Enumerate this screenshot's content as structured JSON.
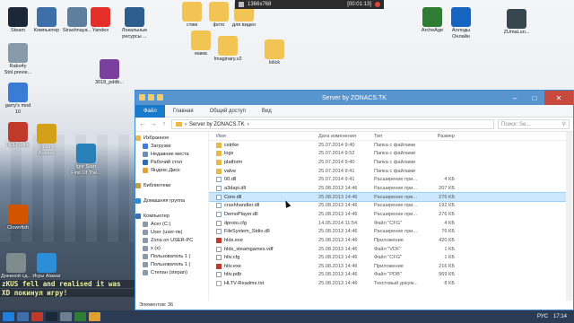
{
  "desktop": {
    "icons_left": [
      {
        "label": "Steam",
        "icon": "steam-icon",
        "color": "#1b2838"
      },
      {
        "label": "Компьютер",
        "icon": "computer-icon",
        "color": "#3d6fa8"
      },
      {
        "label": "Strashnaya...",
        "icon": "document-icon",
        "color": "#5f7f9f"
      },
      {
        "label": "Yandex",
        "icon": "yandex-icon",
        "color": "#e5302a"
      },
      {
        "label": "Локальные\nресурсы ...",
        "icon": "network-icon",
        "color": "#2d5d8d"
      }
    ],
    "icons_col1": [
      {
        "label": "Rabo4y\nStol.previe...",
        "icon": "image-icon",
        "color": "#8899aa"
      },
      {
        "label": "garry's mod\n10",
        "icon": "gmod-icon",
        "color": "#3a7bd5"
      },
      {
        "label": "NCH Suite",
        "icon": "nch-icon",
        "color": "#c0392b"
      },
      {
        "label": "Clownfish",
        "icon": "clownfish-icon",
        "color": "#d35400"
      },
      {
        "label": "Дневной сд...",
        "icon": "user-icon",
        "color": "#7f8c8d"
      }
    ],
    "icons_col2": [
      {
        "label": "3018_pddb...",
        "icon": "archive-icon",
        "color": "#7b3f9e"
      },
      {
        "label": "Казино\nАльянс",
        "icon": "crown-icon",
        "color": "#d4a017"
      },
      {
        "label": "Igor Starr\nFirst Of The...",
        "icon": "music-icon",
        "color": "#2980b9"
      },
      {
        "label": "Игры Alawar",
        "icon": "alawar-icon",
        "color": "#2c8ed6"
      }
    ],
    "folders_top": [
      {
        "label": "стим"
      },
      {
        "label": "фото"
      },
      {
        "label": "для видео"
      },
      {
        "label": "мама"
      },
      {
        "label": "Imaginary.v2"
      },
      {
        "label": "lolick"
      }
    ],
    "icons_right": [
      {
        "label": "ArcheAge",
        "icon": "archeage-icon",
        "color": "#2e7d32"
      },
      {
        "label": "Аллоды\nОнлайн",
        "icon": "allods-icon",
        "color": "#1565c0"
      },
      {
        "label": "ZUmaLun...",
        "icon": "zuma-icon",
        "color": "#37474f"
      }
    ],
    "chat_lines": [
      "zKUS fell and realised it was",
      "XD покинул игру!"
    ]
  },
  "record_bar": {
    "resolution": "1366x768",
    "timer": "[00:01:13]"
  },
  "window": {
    "title": "Server by ZONACS.TK",
    "ribbon_tabs": [
      "Файл",
      "Главная",
      "Общий доступ",
      "Вид"
    ],
    "address": "Server by ZONACS.TK",
    "search_placeholder": "Поиск: Se...",
    "nav": {
      "favorites": "Избранное",
      "downloads": "Загрузки",
      "recent": "Недавние места",
      "desktop": "Рабочий стол",
      "yadisk": "Яндекс.Диск",
      "libraries": "Библиотеки",
      "homegroup": "Домашняя группа",
      "computer": "Компьютер",
      "drive_c": "Acer (C:)",
      "drive_user": "User (user-пк)",
      "zona": "Zona on USER-PC",
      "drive_x": "x (x)",
      "user1a": "Пользователь 1 (",
      "user1b": "Пользователь 1 (",
      "stepan": "Степан (stepan)"
    },
    "columns": {
      "name": "Имя",
      "date": "Дата изменения",
      "type": "Тип",
      "size": "Размер"
    },
    "files": [
      {
        "name": "cstrike",
        "date": "25.07.2014 9:40",
        "type": "Папка с файлами",
        "size": "",
        "kind": "folder"
      },
      {
        "name": "logs",
        "date": "25.07.2014 9:52",
        "type": "Папка с файлами",
        "size": "",
        "kind": "folder"
      },
      {
        "name": "platform",
        "date": "25.07.2014 9:40",
        "type": "Папка с файлами",
        "size": "",
        "kind": "folder"
      },
      {
        "name": "valve",
        "date": "25.07.2014 9:41",
        "type": "Папка с файлами",
        "size": "",
        "kind": "folder"
      },
      {
        "name": "00.dll",
        "date": "25.07.2014 9:41",
        "type": "Расширение при...",
        "size": "4 КБ",
        "kind": "dll"
      },
      {
        "name": "a3dapi.dll",
        "date": "25.08.2013 14:46",
        "type": "Расширение при...",
        "size": "207 КБ",
        "kind": "dll"
      },
      {
        "name": "Core.dll",
        "date": "25.08.2013 14:46",
        "type": "Расширение при...",
        "size": "276 КБ",
        "kind": "dll",
        "selected": true
      },
      {
        "name": "crashhandler.dll",
        "date": "25.08.2013 14:46",
        "type": "Расширение при...",
        "size": "192 КБ",
        "kind": "dll"
      },
      {
        "name": "DemoPlayer.dll",
        "date": "25.08.2013 14:46",
        "type": "Расширение при...",
        "size": "276 КБ",
        "kind": "dll"
      },
      {
        "name": "dproto.cfg",
        "date": "14.05.2014 11:54",
        "type": "Файл \"CFG\"",
        "size": "4 КБ",
        "kind": "cfg"
      },
      {
        "name": "FileSystem_Stdio.dll",
        "date": "25.08.2013 14:46",
        "type": "Расширение при...",
        "size": "76 КБ",
        "kind": "dll"
      },
      {
        "name": "hlds.exe",
        "date": "25.08.2013 14:46",
        "type": "Приложение",
        "size": "420 КБ",
        "kind": "exe"
      },
      {
        "name": "hlds_steamgames.vdf",
        "date": "25.08.2013 14:46",
        "type": "Файл \"VDF\"",
        "size": "1 КБ",
        "kind": "cfg"
      },
      {
        "name": "hltv.cfg",
        "date": "25.08.2013 14:46",
        "type": "Файл \"CFG\"",
        "size": "1 КБ",
        "kind": "cfg"
      },
      {
        "name": "hltv.exe",
        "date": "25.08.2013 14:46",
        "type": "Приложение",
        "size": "216 КБ",
        "kind": "exe"
      },
      {
        "name": "hltv.pdb",
        "date": "25.08.2013 14:46",
        "type": "Файл \"PDB\"",
        "size": "969 КБ",
        "kind": "cfg"
      },
      {
        "name": "HLTV-Readme.txt",
        "date": "25.08.2013 14:46",
        "type": "Текстовый докум...",
        "size": "8 КБ",
        "kind": "txt"
      }
    ],
    "status": "Элементов: 36"
  },
  "taskbar": {
    "lang": "РУС",
    "time": "17:14"
  }
}
